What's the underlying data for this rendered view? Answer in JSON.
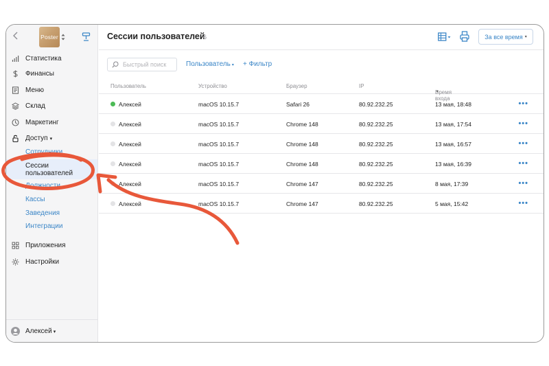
{
  "sidebar": {
    "logo_text": "Poster",
    "nav": [
      {
        "label": "Статистика",
        "icon": "bar-chart-icon"
      },
      {
        "label": "Финансы",
        "icon": "dollar-icon"
      },
      {
        "label": "Меню",
        "icon": "document-icon"
      },
      {
        "label": "Склад",
        "icon": "layers-icon"
      },
      {
        "label": "Маркетинг",
        "icon": "marketing-icon"
      },
      {
        "label": "Доступ",
        "icon": "lock-icon",
        "caret": "▾"
      }
    ],
    "access_sub": [
      {
        "label": "Сотрудники"
      },
      {
        "label": "Сессии пользователей",
        "active": true
      },
      {
        "label": "Должности"
      },
      {
        "label": "Кассы"
      },
      {
        "label": "Заведения"
      },
      {
        "label": "Интеграции"
      }
    ],
    "nav_bottom": [
      {
        "label": "Приложения",
        "icon": "grid-icon"
      },
      {
        "label": "Настройки",
        "icon": "gear-icon"
      }
    ],
    "user": {
      "name": "Алексей",
      "caret": "▾"
    }
  },
  "header": {
    "title": "Сессии пользователей",
    "count": "6",
    "period_button": "За все время",
    "period_caret": "▾"
  },
  "filters": {
    "search_placeholder": "Быстрый поиск",
    "user_filter": "Пользователь",
    "user_caret": "▾",
    "add_filter": "+ Фильтр"
  },
  "table": {
    "columns": [
      "Пользователь",
      "Устройство",
      "Браузер",
      "IP",
      "Время входа"
    ],
    "sort_caret": "▾",
    "more_glyph": "•••",
    "rows": [
      {
        "user": "Алексей",
        "online": true,
        "device": "macOS 10.15.7",
        "browser": "Safari 26",
        "ip": "80.92.232.25",
        "time": "13 мая, 18:48"
      },
      {
        "user": "Алексей",
        "online": false,
        "device": "macOS 10.15.7",
        "browser": "Chrome 148",
        "ip": "80.92.232.25",
        "time": "13 мая, 17:54"
      },
      {
        "user": "Алексей",
        "online": false,
        "device": "macOS 10.15.7",
        "browser": "Chrome 148",
        "ip": "80.92.232.25",
        "time": "13 мая, 16:57"
      },
      {
        "user": "Алексей",
        "online": false,
        "device": "macOS 10.15.7",
        "browser": "Chrome 148",
        "ip": "80.92.232.25",
        "time": "13 мая, 16:39"
      },
      {
        "user": "Алексей",
        "online": false,
        "device": "macOS 10.15.7",
        "browser": "Chrome 147",
        "ip": "80.92.232.25",
        "time": "8 мая, 17:39"
      },
      {
        "user": "Алексей",
        "online": false,
        "device": "macOS 10.15.7",
        "browser": "Chrome 147",
        "ip": "80.92.232.25",
        "time": "5 мая, 15:42"
      }
    ]
  },
  "colors": {
    "accent": "#3b86c7",
    "online": "#4cbb56",
    "offline": "#e3e3e5",
    "annotation": "#e8583a",
    "active_bg": "#e7eefa"
  }
}
